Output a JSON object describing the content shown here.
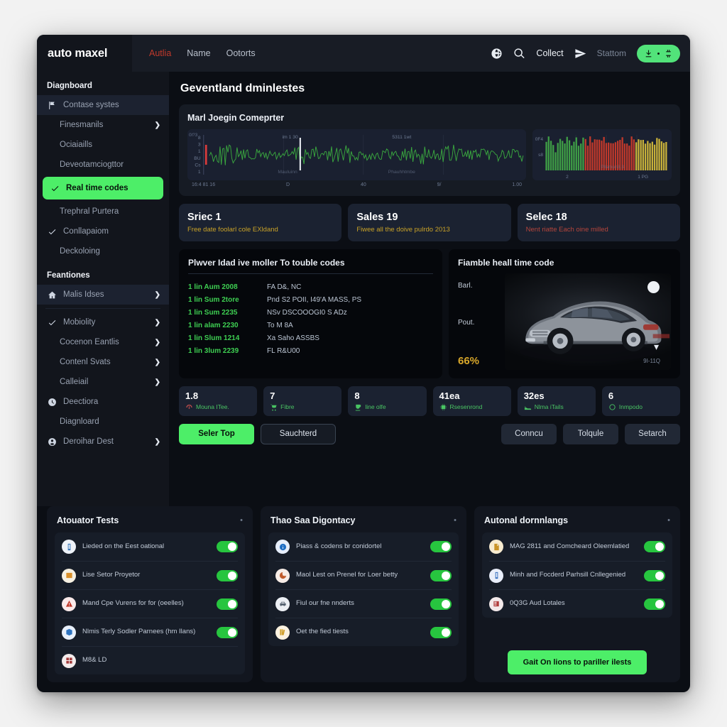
{
  "header": {
    "brand": "auto maxel",
    "tabs": [
      {
        "label": "Autlia",
        "active": true
      },
      {
        "label": "Name",
        "active": false
      },
      {
        "label": "Ootorts",
        "active": false
      }
    ],
    "globe_icon": "globe-icon",
    "search_icon": "search-icon",
    "collect_label": "Collect",
    "send_icon": "send-icon",
    "station_label": "Stattom",
    "download_button_icon": "download-icon",
    "accent_green": "#4dee68",
    "tab_active_color": "#c0392b"
  },
  "sidebar": {
    "section1_title": "Diagnboard",
    "section1_items": [
      {
        "label": "Contase systes",
        "icon": "flag-icon",
        "caret": false,
        "highlight": true,
        "sub": false,
        "check": false,
        "active": false
      },
      {
        "label": "Finesmanils",
        "icon": "",
        "caret": true,
        "highlight": false,
        "sub": true,
        "check": false,
        "active": false
      },
      {
        "label": "Ociaiaills",
        "icon": "",
        "caret": false,
        "highlight": false,
        "sub": true,
        "check": false,
        "active": false
      },
      {
        "label": "Deveotamciogttor",
        "icon": "",
        "caret": false,
        "highlight": false,
        "sub": true,
        "check": false,
        "active": false
      },
      {
        "label": "Real time codes",
        "icon": "check-icon",
        "caret": false,
        "highlight": false,
        "sub": false,
        "check": true,
        "active": true
      },
      {
        "label": "Trephral Purtera",
        "icon": "",
        "caret": false,
        "highlight": false,
        "sub": true,
        "check": false,
        "active": false
      },
      {
        "label": "Conllapaiom",
        "icon": "check-icon",
        "caret": false,
        "highlight": false,
        "sub": false,
        "check": true,
        "active": false
      },
      {
        "label": "Deckoloing",
        "icon": "",
        "caret": false,
        "highlight": false,
        "sub": true,
        "check": false,
        "active": false
      }
    ],
    "section2_title": "Feantiones",
    "section2_items": [
      {
        "label": "Malis Idses",
        "icon": "home-icon",
        "caret": true,
        "highlight": true,
        "sub": false,
        "check": false,
        "active": false
      },
      {
        "label": "Mobiolity",
        "icon": "check-icon",
        "caret": true,
        "highlight": false,
        "sub": false,
        "check": true,
        "active": false
      },
      {
        "label": "Cocenon Eantlis",
        "icon": "",
        "caret": true,
        "highlight": false,
        "sub": true,
        "check": false,
        "active": false
      },
      {
        "label": "Contenl Svats",
        "icon": "",
        "caret": true,
        "highlight": false,
        "sub": true,
        "check": false,
        "active": false
      },
      {
        "label": "Calleiail",
        "icon": "",
        "caret": true,
        "highlight": false,
        "sub": true,
        "check": false,
        "active": false
      },
      {
        "label": "Deectiora",
        "icon": "clock-icon",
        "caret": false,
        "highlight": false,
        "sub": false,
        "check": false,
        "active": false
      },
      {
        "label": "Diagnloard",
        "icon": "",
        "caret": false,
        "highlight": false,
        "sub": true,
        "check": false,
        "active": false
      },
      {
        "label": "Deroihar Dest",
        "icon": "badge-icon",
        "caret": true,
        "highlight": false,
        "sub": false,
        "check": false,
        "active": false
      }
    ]
  },
  "main": {
    "page_title": "Geventland dminlestes",
    "chart_panel_title": "Marl Joegin Comeprter",
    "stats": [
      {
        "title": "Sriec 1",
        "sub": "Free date foolarl cole EXldand",
        "tone": "yellow"
      },
      {
        "title": "Sales 19",
        "sub": "Fiwee all the doive pulrdo 2013",
        "tone": "yellow"
      },
      {
        "title": "Selec 18",
        "sub": "Nent riatte Each oine milled",
        "tone": "red"
      }
    ],
    "dtc": {
      "title": "Plwver Idad ive moller To touble codes",
      "rows": [
        {
          "code": "1 lin Aum 2008",
          "desc": "FA D&, NC"
        },
        {
          "code": "1 lin Sum 2tore",
          "desc": "Pnd S2 POII, I49'A MASS, PS"
        },
        {
          "code": "1 lin Sum 2235",
          "desc": "NSv DSCOOOGI0 S ADz"
        },
        {
          "code": "1 lin alam 2230",
          "desc": "To M 8A"
        },
        {
          "code": "1 lin Slum 1214",
          "desc": "Xa Saho ASSBS"
        },
        {
          "code": "1 lin 3lum 2239",
          "desc": "FL R&U00"
        }
      ]
    },
    "vehicle": {
      "title": "Fiamble heall time code",
      "label1": "Barl.",
      "label2": "Pout.",
      "percent": "66%",
      "stamp": "9I-11Q",
      "chevron_icon": "chevron-down-icon",
      "moon_icon": "moon-icon"
    },
    "chips": [
      {
        "value": "1.8",
        "label": "Mouna ITee.",
        "icon": "gauge-icon",
        "ring": "#b44a4a"
      },
      {
        "value": "7",
        "label": "Fibre",
        "icon": "cart-icon",
        "ring": "#49c463"
      },
      {
        "value": "8",
        "label": "line olfe",
        "icon": "cup-icon",
        "ring": "#49c463"
      },
      {
        "value": "41ea",
        "label": "Rsesenrond",
        "icon": "chip-icon",
        "ring": "#49c463"
      },
      {
        "value": "32es",
        "label": "Nlma iTails",
        "icon": "shoe-icon",
        "ring": "#49c463"
      },
      {
        "value": "6",
        "label": "Inmpodo",
        "icon": "circle-icon",
        "ring": "#49c463"
      }
    ],
    "actions": {
      "primary": "Seler Top",
      "outline": "Sauchterd",
      "ghost": [
        "Conncu",
        "Tolqule",
        "Setarch"
      ]
    }
  },
  "bottom_panels": [
    {
      "title": "Atouator Tests",
      "menu_icon": "more-icon",
      "items": [
        {
          "label": "Lieded on the Eest oational",
          "toggle": true,
          "has_toggle": true,
          "icon_bg": "#eef2f8",
          "icon_fg": "#2d6fb5",
          "icon": "device-icon"
        },
        {
          "label": "Lise Setor Proyetor",
          "toggle": true,
          "has_toggle": true,
          "icon_bg": "#f6f0e2",
          "icon_fg": "#d98f2a",
          "icon": "image-icon"
        },
        {
          "label": "Mand Cpe Vurens for for (oeelles)",
          "toggle": true,
          "has_toggle": true,
          "icon_bg": "#fbeaea",
          "icon_fg": "#c0392b",
          "icon": "alert-icon"
        },
        {
          "label": "Nlmis Terly Sodler Parnees (hm Ilans)",
          "toggle": true,
          "has_toggle": true,
          "icon_bg": "#e8f0fb",
          "icon_fg": "#2f74c0",
          "icon": "box-icon"
        },
        {
          "label": "M8& LD",
          "toggle": false,
          "has_toggle": false,
          "icon_bg": "#f4ecec",
          "icon_fg": "#a33b3b",
          "icon": "grid-icon"
        }
      ],
      "cta": null
    },
    {
      "title": "Thao Saa Digontacy",
      "menu_icon": "more-icon",
      "items": [
        {
          "label": "Piass & codens br conidortel",
          "toggle": true,
          "has_toggle": true,
          "icon_bg": "#e6eefb",
          "icon_fg": "#1f6fc4",
          "icon": "info-icon"
        },
        {
          "label": "Maol Lest on Prenel for Loer betty",
          "toggle": true,
          "has_toggle": true,
          "icon_bg": "#f7ece6",
          "icon_fg": "#c05a2a",
          "icon": "swirl-icon"
        },
        {
          "label": "Fiul our fne nnderts",
          "toggle": true,
          "has_toggle": true,
          "icon_bg": "#eceff4",
          "icon_fg": "#54606f",
          "icon": "car-icon"
        },
        {
          "label": "Oet the fied tiests",
          "toggle": true,
          "has_toggle": true,
          "icon_bg": "#fbf2e0",
          "icon_fg": "#d0a02e",
          "icon": "books-icon"
        }
      ],
      "cta": null
    },
    {
      "title": "Autonal dornnlangs",
      "menu_icon": "more-icon",
      "items": [
        {
          "label": "MAG 2811 and Comcheard Oleemlatied",
          "toggle": true,
          "has_toggle": true,
          "icon_bg": "#f7ebcf",
          "icon_fg": "#c99327",
          "icon": "doc-icon"
        },
        {
          "label": "Minh and Focderd Parhsill Cnllegenied",
          "toggle": true,
          "has_toggle": true,
          "icon_bg": "#e9eefa",
          "icon_fg": "#2f6bbd",
          "icon": "device-icon"
        },
        {
          "label": "0Q3G Aud Lotales",
          "toggle": true,
          "has_toggle": true,
          "icon_bg": "#f3e9ea",
          "icon_fg": "#b03a3a",
          "icon": "news-icon"
        }
      ],
      "cta": "Gait On lions to pariller ilests"
    }
  ],
  "chart_data": [
    {
      "type": "line",
      "title": "Marl Joegin Comeprter",
      "series_name": "signal",
      "color": "#3aa93f",
      "marker_color": "#d93b3b",
      "cursor_color": "#e8ecf2",
      "ylabel": "0I?3",
      "y_ticks": [
        "8",
        "3",
        "1",
        "BU",
        "Cs",
        "1"
      ],
      "x_ticks": [
        "16:4 81 16",
        "D",
        "40",
        "9/",
        "1.00"
      ],
      "annotations": [
        "im 1 30",
        "5311 1wt",
        "Mauluinn",
        "Phauhhtmbe"
      ],
      "grid": true,
      "n_points": 240,
      "ylim": [
        0,
        10
      ]
    },
    {
      "type": "bar",
      "title": "",
      "segments": [
        {
          "name": "green",
          "color": "#3f9e46",
          "count": 17
        },
        {
          "name": "red",
          "color": "#c0392b",
          "count": 22
        },
        {
          "name": "yellow",
          "color": "#c8b13a",
          "count": 14
        }
      ],
      "y_ticks": [
        "0F4",
        "s8"
      ],
      "x_ticks": [
        "2",
        "1 PG"
      ],
      "annotations": [
        "Pllamun3.3"
      ],
      "grid": true,
      "ylim": [
        0,
        10
      ]
    }
  ]
}
